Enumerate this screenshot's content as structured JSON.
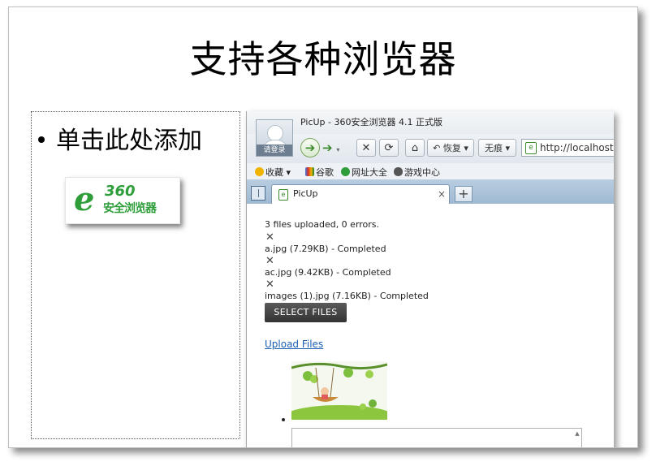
{
  "slide": {
    "title": "支持各种浏览器",
    "bullet": "单击此处添加",
    "logo": {
      "number": "360",
      "name": "安全浏览器",
      "icon": "ie-style-e-icon",
      "color": "#2e9e3a"
    }
  },
  "browser": {
    "window_title": "PicUp - 360安全浏览器 4.1 正式版",
    "avatar_label": "请登录",
    "toolbar": {
      "back_icon": "arrow-left-icon",
      "forward_icon": "arrow-right-icon",
      "stop_glyph": "✕",
      "refresh_glyph": "⟳",
      "home_glyph": "⌂",
      "restore_label": "↶ 恢复 ▾",
      "incognito_label": "无痕 ▾",
      "address": "http://localhost:"
    },
    "bookmarks": [
      {
        "label": "收藏 ▾",
        "icon": "star-icon"
      },
      {
        "label": "谷歌",
        "icon": "google-icon"
      },
      {
        "label": "网址大全",
        "icon": "ie-icon"
      },
      {
        "label": "游戏中心",
        "icon": "gamepad-icon"
      }
    ],
    "tab": {
      "label": "PicUp",
      "close_glyph": "×"
    },
    "new_tab_glyph": "+",
    "page": {
      "summary": "3 files uploaded, 0 errors.",
      "files": [
        {
          "text": "a.jpg (7.29KB) - Completed"
        },
        {
          "text": "ac.jpg (9.42KB) - Completed"
        },
        {
          "text": "images (1).jpg (7.16KB) - Completed"
        }
      ],
      "remove_glyph": "✕",
      "select_button": "SELECT FILES",
      "upload_link": "Upload Files"
    }
  }
}
